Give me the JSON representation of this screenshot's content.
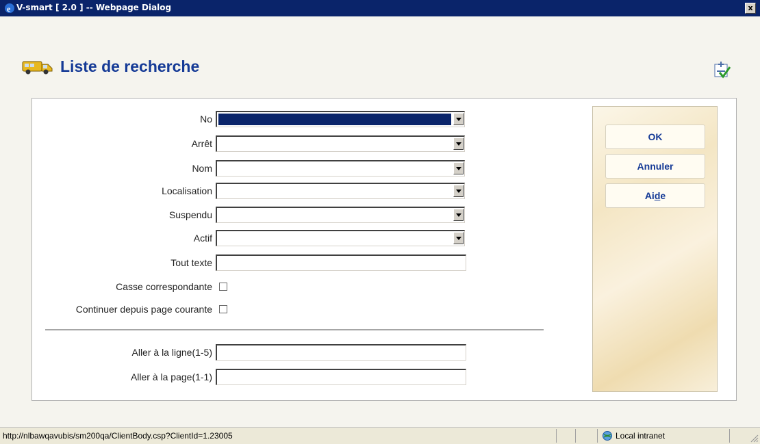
{
  "window": {
    "title": "V-smart [ 2.0 ] -- Webpage Dialog",
    "close_label": "x"
  },
  "page": {
    "title": "Liste de recherche"
  },
  "form": {
    "fields": [
      {
        "label": "No",
        "type": "select",
        "value": ""
      },
      {
        "label": "Arrêt",
        "type": "select",
        "value": ""
      },
      {
        "label": "Nom",
        "type": "select",
        "value": ""
      },
      {
        "label": "Localisation",
        "type": "select",
        "value": ""
      },
      {
        "label": "Suspendu",
        "type": "select",
        "value": ""
      },
      {
        "label": "Actif",
        "type": "select",
        "value": ""
      },
      {
        "label": "Tout texte",
        "type": "text",
        "value": ""
      },
      {
        "label": "Casse correspondante",
        "type": "checkbox",
        "checked": false
      },
      {
        "label": "Continuer depuis page courante",
        "type": "checkbox",
        "checked": false
      },
      {
        "label": "Aller à la ligne(1-5)",
        "type": "text",
        "value": ""
      },
      {
        "label": "Aller à la page(1-1)",
        "type": "text",
        "value": ""
      }
    ]
  },
  "buttons": {
    "ok": "OK",
    "cancel": "Annuler",
    "help_pre": "Ai",
    "help_u": "d",
    "help_post": "e"
  },
  "statusbar": {
    "url": "http://nlbawqavubis/sm200qa/ClientBody.csp?ClientId=1.23005",
    "zone": "Local intranet"
  },
  "icons": {
    "app": "ie-icon",
    "title": "truck-icon",
    "tool": "settings-check-icon",
    "zone": "globe-icon"
  }
}
